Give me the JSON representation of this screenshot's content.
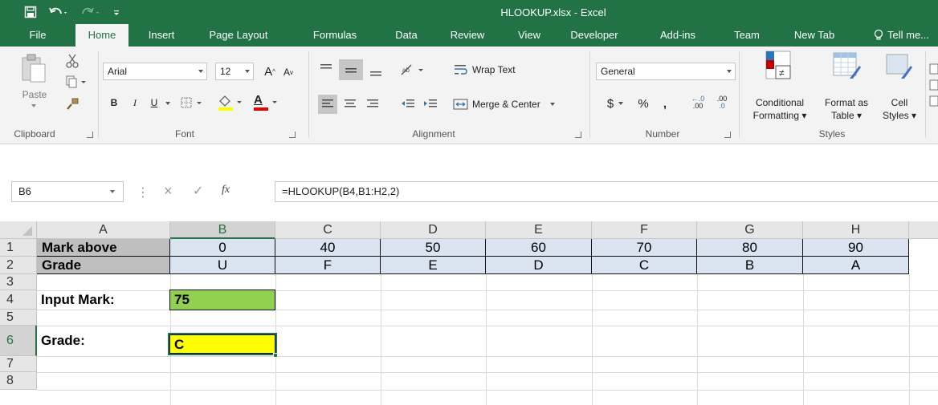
{
  "app": {
    "title": "HLOOKUP.xlsx - Excel",
    "accent": "#217346"
  },
  "tabs": [
    {
      "label": "File"
    },
    {
      "label": "Home",
      "active": true
    },
    {
      "label": "Insert"
    },
    {
      "label": "Page Layout"
    },
    {
      "label": "Formulas"
    },
    {
      "label": "Data"
    },
    {
      "label": "Review"
    },
    {
      "label": "View"
    },
    {
      "label": "Developer"
    },
    {
      "label": "Add-ins"
    },
    {
      "label": "Team"
    },
    {
      "label": "New Tab"
    },
    {
      "label": "Tell me..."
    }
  ],
  "ribbon": {
    "clipboard": {
      "label": "Clipboard",
      "paste": "Paste"
    },
    "font": {
      "label": "Font",
      "name": "Arial",
      "size": "12",
      "bold": "B",
      "italic": "I",
      "underline": "U",
      "grow": "A",
      "shrink": "A",
      "font_color_letter": "A"
    },
    "alignment": {
      "label": "Alignment",
      "wrap_text": "Wrap Text",
      "merge_center": "Merge & Center"
    },
    "number": {
      "label": "Number",
      "format": "General",
      "currency": "$",
      "percent": "%",
      "comma": ",",
      "inc_decimal": ".00",
      "dec_decimal": ".0"
    },
    "styles": {
      "label": "Styles",
      "conditional": [
        "Conditional",
        "Formatting"
      ],
      "format_as": [
        "Format as",
        "Table"
      ],
      "cell": [
        "Cell",
        "Styles"
      ]
    }
  },
  "formula_bar": {
    "name_box": "B6",
    "cancel": "×",
    "enter": "✓",
    "fx": "fx",
    "formula": "=HLOOKUP(B4,B1:H2,2)"
  },
  "sheet": {
    "columns": [
      "A",
      "B",
      "C",
      "D",
      "E",
      "F",
      "G",
      "H"
    ],
    "selected_column": "B",
    "rows": [
      "1",
      "2",
      "3",
      "4",
      "5",
      "6",
      "7",
      "8"
    ],
    "selected_row": "6",
    "row1": {
      "label": "Mark above",
      "values": [
        "0",
        "40",
        "50",
        "60",
        "70",
        "80",
        "90"
      ]
    },
    "row2": {
      "label": "Grade",
      "values": [
        "U",
        "F",
        "E",
        "D",
        "C",
        "B",
        "A"
      ]
    },
    "row4": {
      "label": "Input Mark:",
      "value": "75",
      "value_color": "#92d050"
    },
    "row6": {
      "label": "Grade:",
      "value": "C",
      "value_color": "#ffff00"
    }
  }
}
